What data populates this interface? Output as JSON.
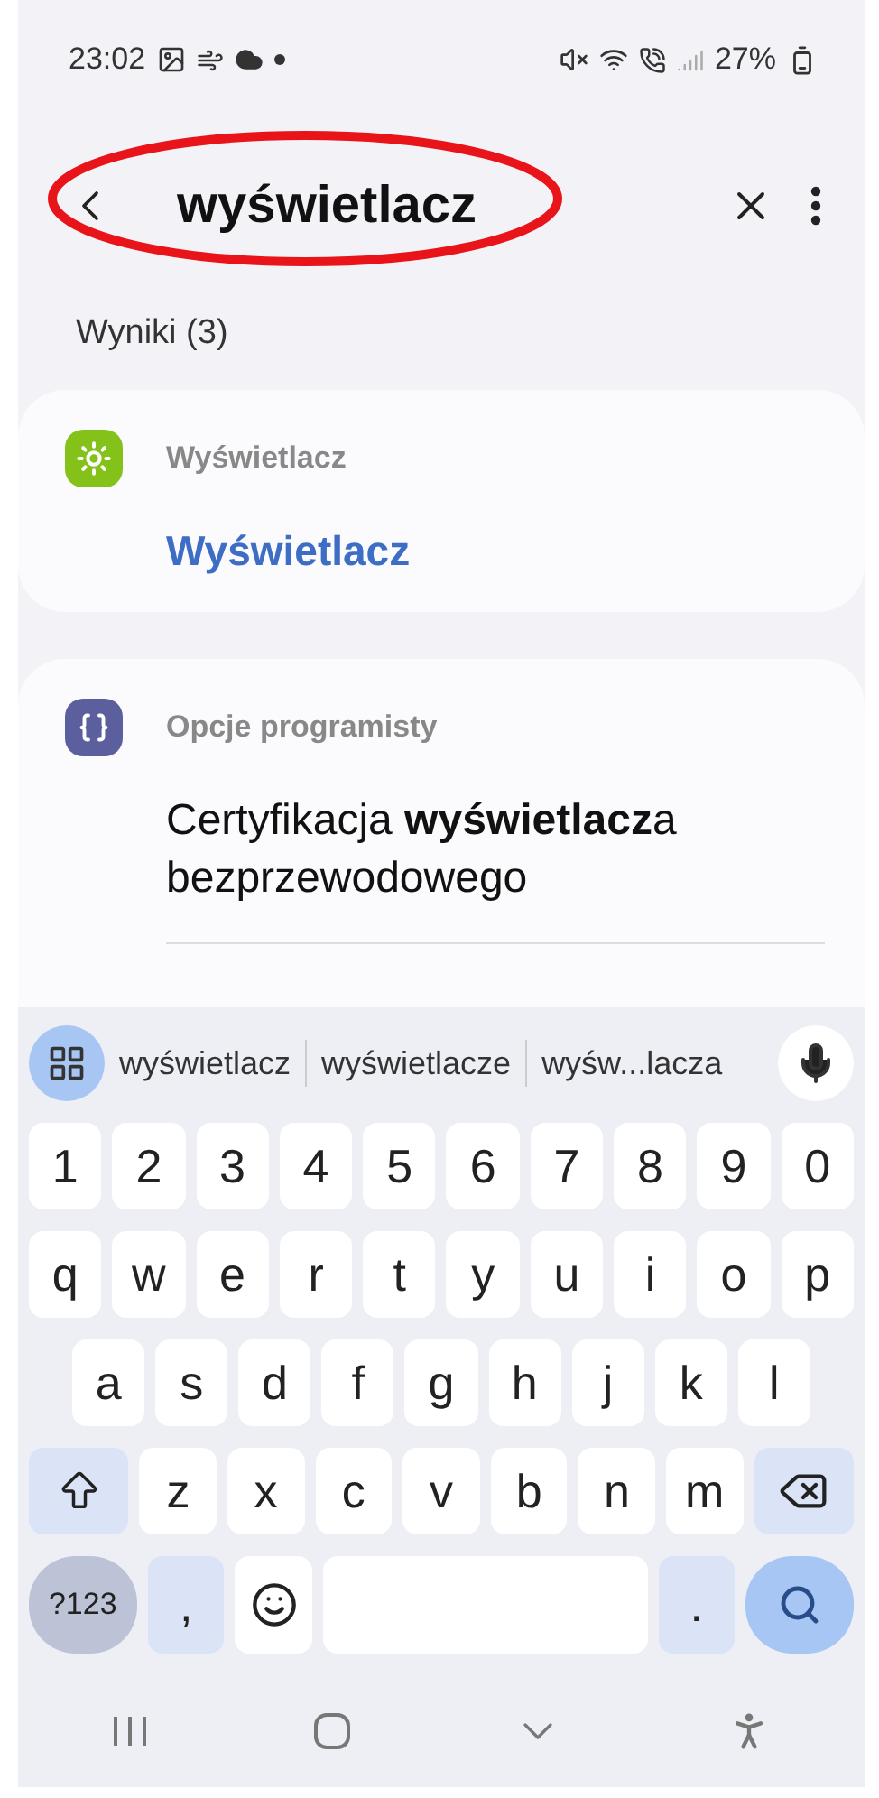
{
  "status_bar": {
    "time": "23:02",
    "battery": "27%"
  },
  "search": {
    "query": "wyświetlacz",
    "circled": true
  },
  "results_label": "Wyniki (3)",
  "results": [
    {
      "category": "Wyświetlacz",
      "kind": "display",
      "color": "#84c21a",
      "title": "Wyświetlacz",
      "match_whole": true
    },
    {
      "category": "Opcje programisty",
      "kind": "developer",
      "color": "#5b5f9e",
      "title": "Certyfikacja **wyświetlacz**a bezprzewodowego",
      "match_whole": false
    }
  ],
  "keyboard": {
    "suggestions": [
      "wyświetlacz",
      "wyświetlacze",
      "wyśw...lacza"
    ],
    "rows": [
      [
        {
          "kind": "char",
          "label": "1"
        },
        {
          "kind": "char",
          "label": "2"
        },
        {
          "kind": "char",
          "label": "3"
        },
        {
          "kind": "char",
          "label": "4"
        },
        {
          "kind": "char",
          "label": "5"
        },
        {
          "kind": "char",
          "label": "6"
        },
        {
          "kind": "char",
          "label": "7"
        },
        {
          "kind": "char",
          "label": "8"
        },
        {
          "kind": "char",
          "label": "9"
        },
        {
          "kind": "char",
          "label": "0"
        }
      ],
      [
        {
          "kind": "char",
          "label": "q"
        },
        {
          "kind": "char",
          "label": "w"
        },
        {
          "kind": "char",
          "label": "e"
        },
        {
          "kind": "char",
          "label": "r"
        },
        {
          "kind": "char",
          "label": "t"
        },
        {
          "kind": "char",
          "label": "y"
        },
        {
          "kind": "char",
          "label": "u"
        },
        {
          "kind": "char",
          "label": "i"
        },
        {
          "kind": "char",
          "label": "o"
        },
        {
          "kind": "char",
          "label": "p"
        }
      ],
      [
        {
          "kind": "char",
          "label": "a"
        },
        {
          "kind": "char",
          "label": "s"
        },
        {
          "kind": "char",
          "label": "d"
        },
        {
          "kind": "char",
          "label": "f"
        },
        {
          "kind": "char",
          "label": "g"
        },
        {
          "kind": "char",
          "label": "h"
        },
        {
          "kind": "char",
          "label": "j"
        },
        {
          "kind": "char",
          "label": "k"
        },
        {
          "kind": "char",
          "label": "l"
        }
      ],
      [
        {
          "kind": "shift"
        },
        {
          "kind": "char",
          "label": "z"
        },
        {
          "kind": "char",
          "label": "x"
        },
        {
          "kind": "char",
          "label": "c"
        },
        {
          "kind": "char",
          "label": "v"
        },
        {
          "kind": "char",
          "label": "b"
        },
        {
          "kind": "char",
          "label": "n"
        },
        {
          "kind": "char",
          "label": "m"
        },
        {
          "kind": "backspace"
        }
      ],
      [
        {
          "kind": "symbols",
          "label": "?123"
        },
        {
          "kind": "punct",
          "label": ","
        },
        {
          "kind": "emoji"
        },
        {
          "kind": "space"
        },
        {
          "kind": "punct",
          "label": "."
        },
        {
          "kind": "search"
        }
      ]
    ]
  }
}
